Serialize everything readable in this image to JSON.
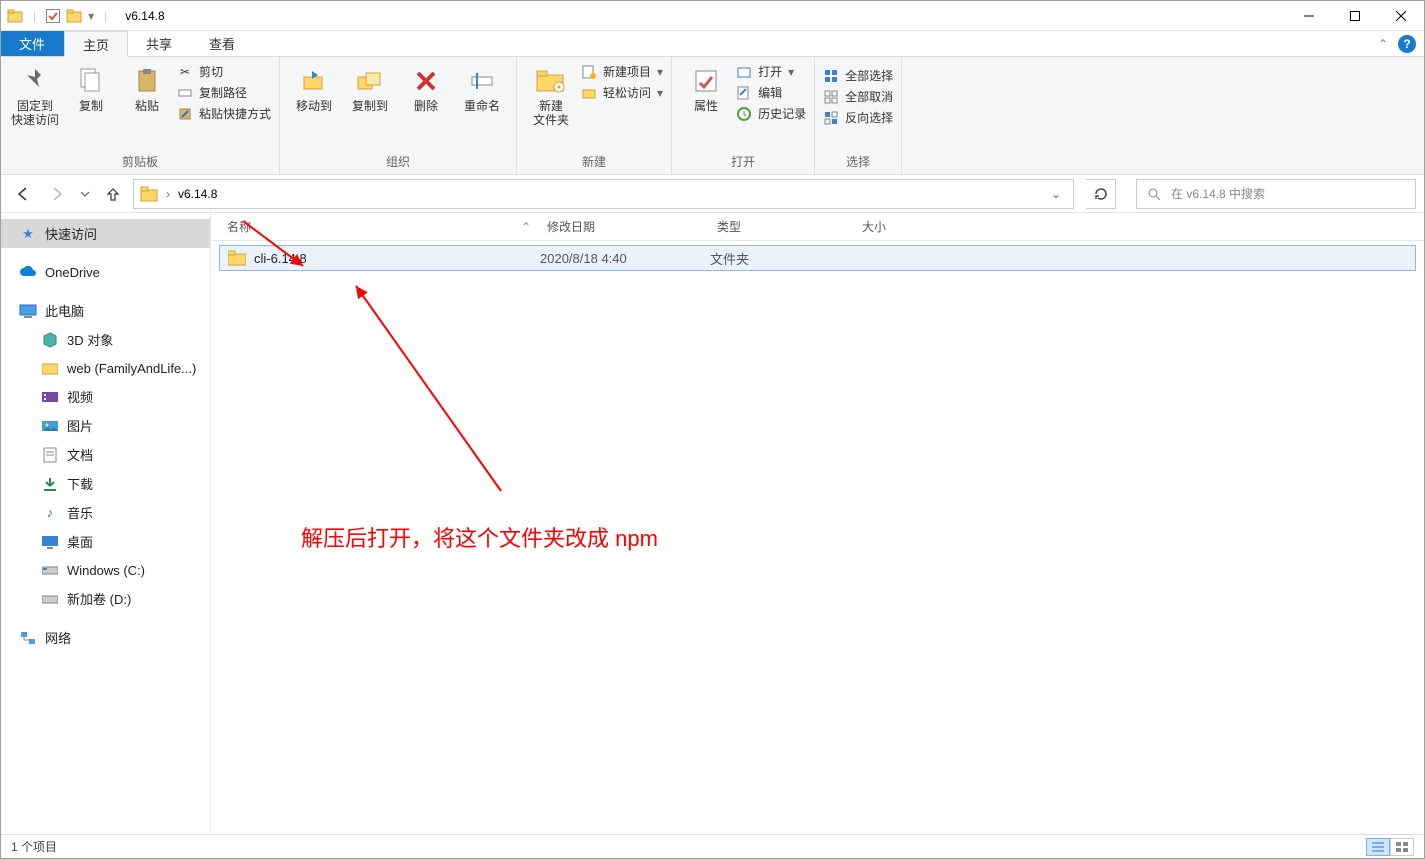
{
  "window": {
    "title": "v6.14.8"
  },
  "tabs": {
    "file": "文件",
    "home": "主页",
    "share": "共享",
    "view": "查看"
  },
  "ribbon": {
    "pin": "固定到\n快速访问",
    "copy": "复制",
    "paste": "粘贴",
    "cut": "剪切",
    "copy_path": "复制路径",
    "paste_shortcut": "粘贴快捷方式",
    "group_clipboard": "剪贴板",
    "move_to": "移动到",
    "copy_to": "复制到",
    "delete": "删除",
    "rename": "重命名",
    "group_organize": "组织",
    "new_folder": "新建\n文件夹",
    "new_item": "新建项目",
    "easy_access": "轻松访问",
    "group_new": "新建",
    "properties": "属性",
    "open": "打开",
    "edit": "编辑",
    "history": "历史记录",
    "group_open": "打开",
    "select_all": "全部选择",
    "select_none": "全部取消",
    "invert": "反向选择",
    "group_select": "选择"
  },
  "address": {
    "segment": "v6.14.8"
  },
  "search": {
    "placeholder": "在 v6.14.8 中搜索"
  },
  "columns": {
    "name": "名称",
    "date": "修改日期",
    "type": "类型",
    "size": "大小"
  },
  "files": [
    {
      "name": "cli-6.14.8",
      "date": "2020/8/18 4:40",
      "type": "文件夹",
      "size": ""
    }
  ],
  "sidebar": {
    "quick_access": "快速访问",
    "onedrive": "OneDrive",
    "this_pc": "此电脑",
    "objects_3d": "3D 对象",
    "web": "web (FamilyAndLife...)",
    "videos": "视频",
    "pictures": "图片",
    "documents": "文档",
    "downloads": "下载",
    "music": "音乐",
    "desktop": "桌面",
    "drive_c": "Windows (C:)",
    "drive_d": "新加卷 (D:)",
    "network": "网络"
  },
  "annotation": "解压后打开，将这个文件夹改成 npm",
  "status": "1 个项目"
}
